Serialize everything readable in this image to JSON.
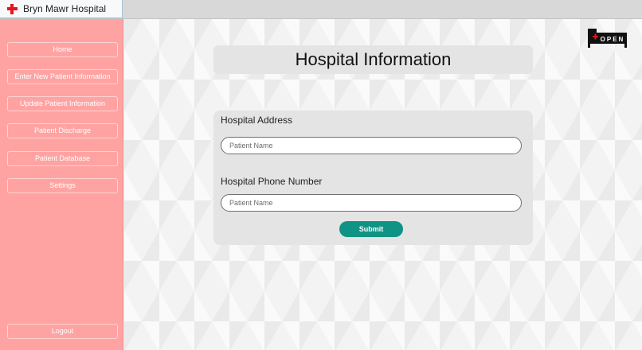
{
  "window": {
    "title": "Bryn Mawr Hospital",
    "icon": "red-cross-icon"
  },
  "sidebar": {
    "items": [
      {
        "label": "Home"
      },
      {
        "label": "Enter New Patient Information"
      },
      {
        "label": "Update Patient Information"
      },
      {
        "label": "Patient Discharge"
      },
      {
        "label": "Patient Database"
      },
      {
        "label": "Settings"
      }
    ],
    "logout_label": "Logout"
  },
  "main": {
    "page_title": "Hospital Information",
    "logo_text": "OPEN",
    "form": {
      "address_label": "Hospital Address",
      "address_placeholder": "Patient Name",
      "address_value": "",
      "phone_label": "Hospital Phone Number",
      "phone_placeholder": "Patient Name",
      "phone_value": "",
      "submit_label": "Submit"
    }
  },
  "colors": {
    "sidebar_bg": "#ffa3a2",
    "submit_bg": "#0e9384",
    "brand_red": "#e5161c"
  }
}
